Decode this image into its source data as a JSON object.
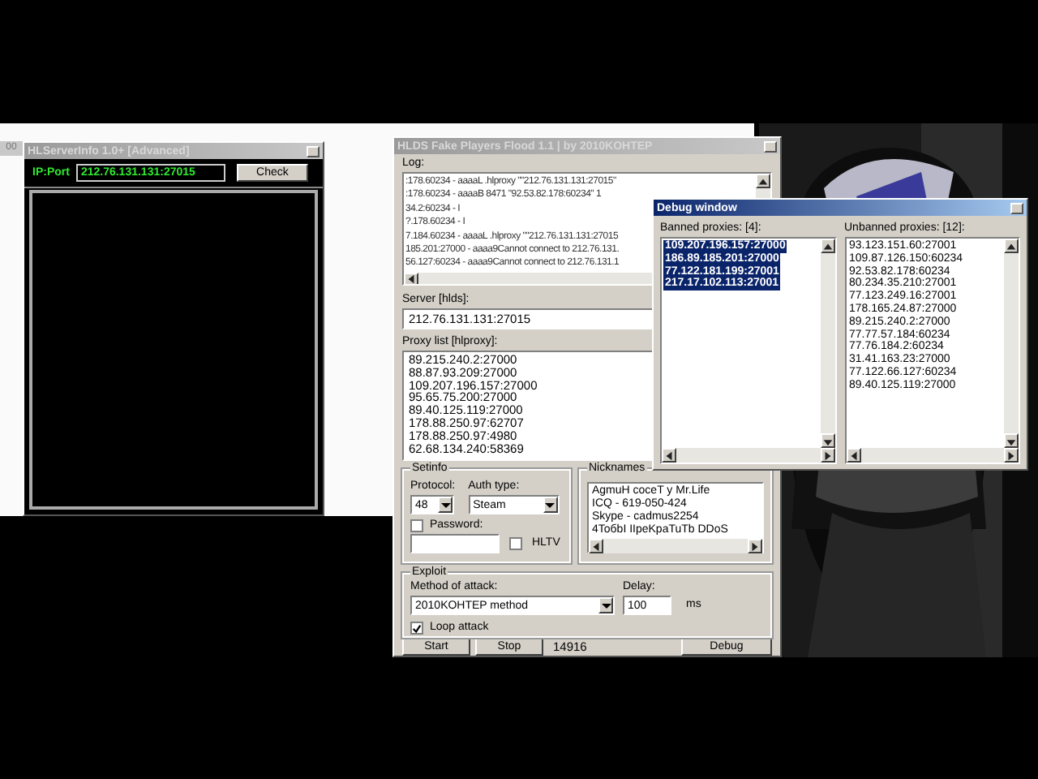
{
  "background_window": {
    "tab_label": "00"
  },
  "server_info": {
    "title": "HLServerInfo 1.0+ [Advanced]",
    "ip_label": "IP:Port",
    "ip_value": "212.76.131.131:27015",
    "check_button": "Check"
  },
  "flood": {
    "title": "HLDS Fake Players Flood 1.1 | by 2010KOHTEP",
    "log_label": "Log:",
    "log_lines": [
      ":178.60234 - aaaaL .hlproxy \"\"212.76.131.131:27015\"",
      ":178.60234 - aaaaB 8471 \"92.53.82.178:60234\" 1",
      "34.2:60234 - I",
      "?.178.60234 - I",
      "7.184.60234 - aaaaL .hlproxy \"\"212.76.131.131:27015",
      "185.201:27000 - aaaa9Cannot connect to 212.76.131.",
      "56.127:60234 - aaaa9Cannot connect to 212.76.131.1"
    ],
    "server_label": "Server [hlds]:",
    "server_value": "212.76.131.131:27015",
    "proxy_label": "Proxy list [hlproxy]:",
    "proxies": [
      "89.215.240.2:27000",
      "88.87.93.209:27000",
      "109.207.196.157:27000",
      "95.65.75.200:27000",
      "89.40.125.119:27000",
      "178.88.250.97:62707",
      "178.88.250.97:4980",
      "62.68.134.240:58369"
    ],
    "setinfo": {
      "title": "Setinfo",
      "protocol_label": "Protocol:",
      "protocol_value": "48",
      "auth_label": "Auth type:",
      "auth_value": "Steam",
      "password": {
        "label": "Password:",
        "checked": false
      },
      "hltv": {
        "label": "HLTV",
        "checked": false
      }
    },
    "nicknames": {
      "title": "Nicknames",
      "items": [
        "AgmuH coceT y Mr.Life",
        "ICQ - 619-050-424",
        "Skype - cadmus2254",
        "4ToбbI IIpeKpaTuTb DDoS"
      ]
    },
    "exploit": {
      "title": "Exploit",
      "method_label": "Method of attack:",
      "method_value": "2010KOHTEP method",
      "delay_label": "Delay:",
      "delay_value": "100",
      "delay_unit": "ms",
      "loop": {
        "label": "Loop attack",
        "checked": true
      }
    },
    "buttons": {
      "start": "Start",
      "stop": "Stop",
      "counter": "14916",
      "debug": "Debug"
    }
  },
  "debug": {
    "title": "Debug window",
    "banned_label": "Banned proxies: [4]:",
    "banned": [
      {
        "text": "109.207.196.157:27000",
        "selected": true
      },
      {
        "text": "186.89.185.201:27000",
        "selected": true
      },
      {
        "text": "77.122.181.199:27001",
        "selected": true
      },
      {
        "text": "217.17.102.113:27001",
        "selected": true
      }
    ],
    "unbanned_label": "Unbanned proxies: [12]:",
    "unbanned": [
      {
        "text": "93.123.151.60:27001",
        "selected": false
      },
      {
        "text": "109.87.126.150:60234",
        "selected": false
      },
      {
        "text": "92.53.82.178:60234",
        "selected": false
      },
      {
        "text": "80.234.35.210:27001",
        "selected": false
      },
      {
        "text": "77.123.249.16:27001",
        "selected": false
      },
      {
        "text": "178.165.24.87:27000",
        "selected": false
      },
      {
        "text": "89.215.240.2:27000",
        "selected": false
      },
      {
        "text": "77.77.57.184:60234",
        "selected": false
      },
      {
        "text": "77.76.184.2:60234",
        "selected": false
      },
      {
        "text": "31.41.163.23:27000",
        "selected": false
      },
      {
        "text": "77.122.66.127:60234",
        "selected": false
      },
      {
        "text": "89.40.125.119:27000",
        "selected": false
      }
    ]
  }
}
